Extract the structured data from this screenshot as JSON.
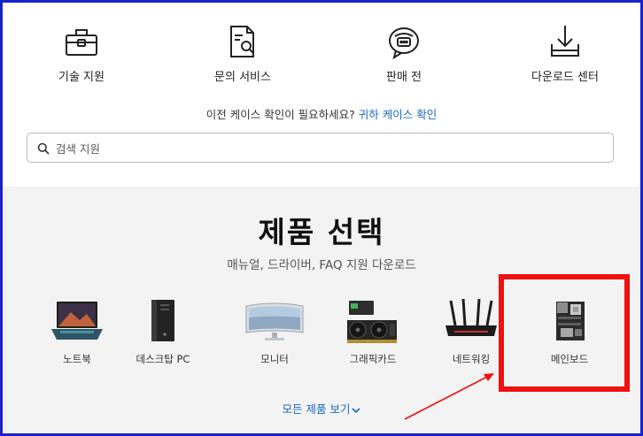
{
  "services": [
    {
      "label": "기술 지원",
      "icon": "toolbox-icon"
    },
    {
      "label": "문의 서비스",
      "icon": "document-search-icon"
    },
    {
      "label": "판매 전",
      "icon": "chat-bubble-icon"
    },
    {
      "label": "다운로드 센터",
      "icon": "download-icon"
    }
  ],
  "case_prompt": {
    "text": "이전 케이스 확인이 필요하세요?",
    "link": "귀하 케이스 확인"
  },
  "search": {
    "placeholder": "검색 지원"
  },
  "product_section": {
    "title": "제품 선택",
    "subtitle": "매뉴얼, 드라이버, FAQ 지원 다운로드",
    "products": [
      {
        "label": "노트북",
        "icon": "laptop-icon"
      },
      {
        "label": "데스크탑 PC",
        "icon": "desktop-tower-icon"
      },
      {
        "label": "모니터",
        "icon": "monitor-icon"
      },
      {
        "label": "그래픽카드",
        "icon": "graphics-card-icon"
      },
      {
        "label": "네트워킹",
        "icon": "router-icon"
      },
      {
        "label": "메인보드",
        "icon": "motherboard-icon"
      }
    ],
    "more": "모든 제품 보기",
    "more_icon": "chevron-down-icon"
  },
  "annotation": {
    "highlight_color": "#ee1111",
    "highlighted_item": "메인보드"
  },
  "colors": {
    "link": "#1667c7",
    "frame": "#1a22c9",
    "section_bg": "#f3f3f3"
  }
}
